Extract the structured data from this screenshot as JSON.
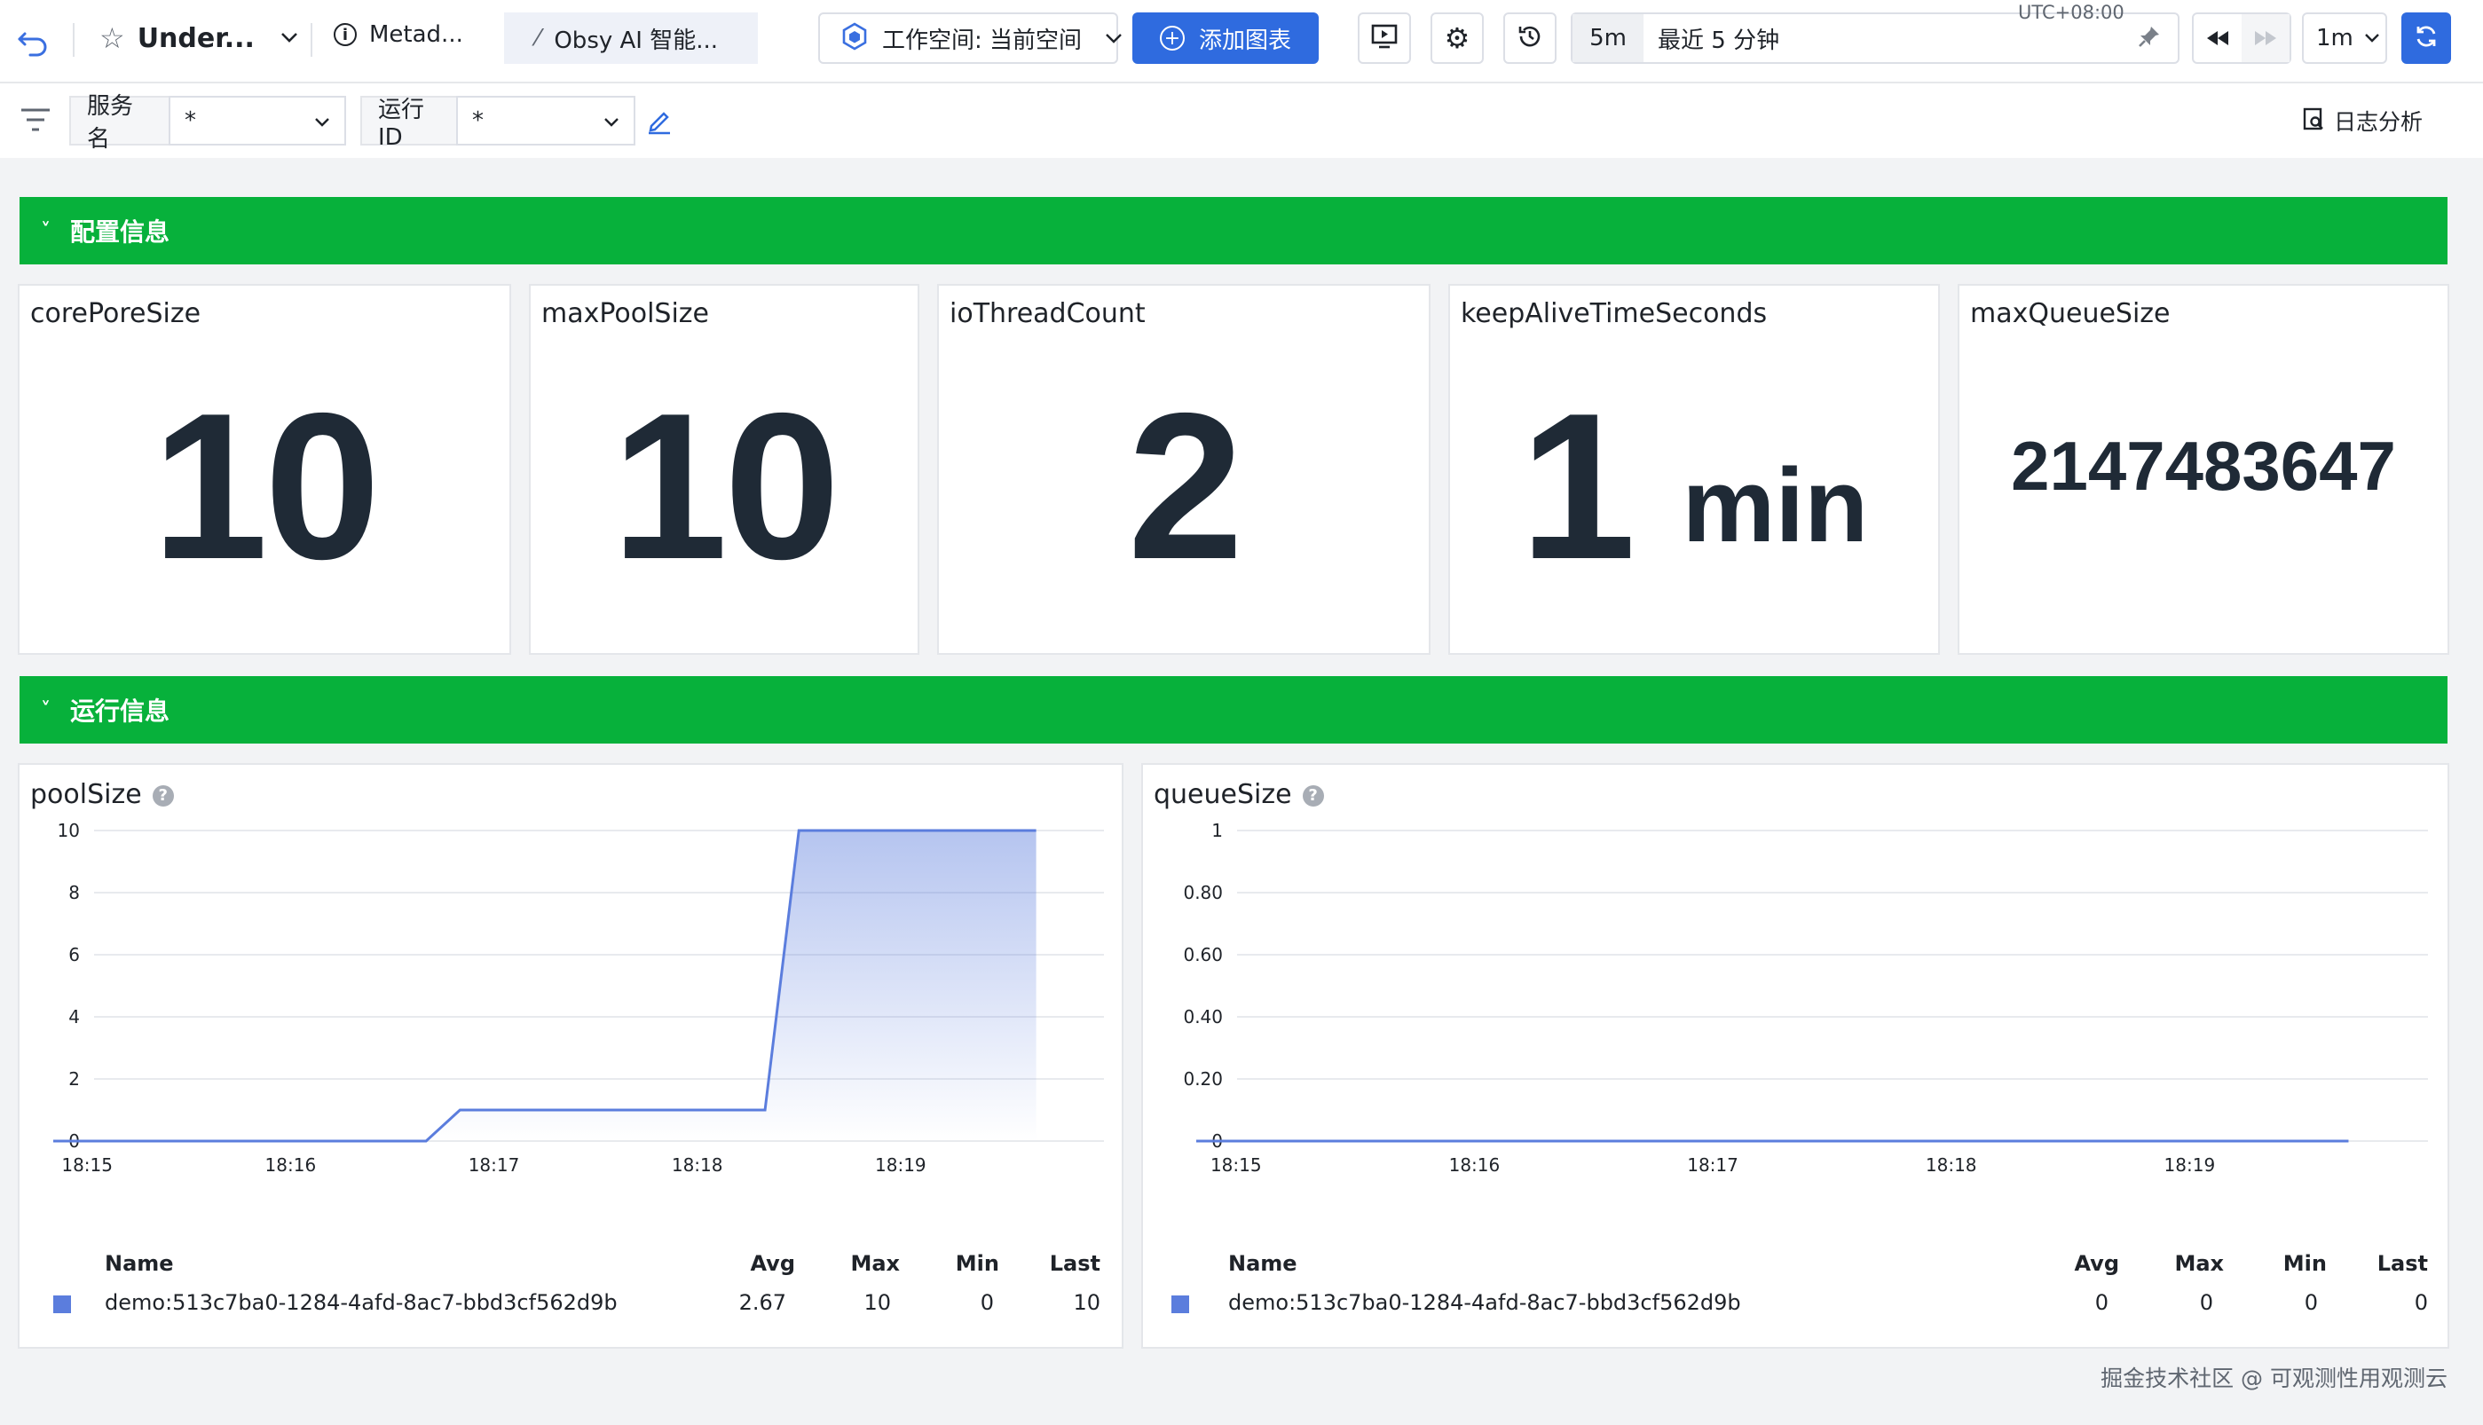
{
  "toolbar": {
    "dashboard_title": "Under...",
    "metadata_label": "Metad...",
    "ai_label": "Obsy AI 智能...",
    "workspace_label": "工作空间: 当前空间",
    "add_chart_label": "添加图表",
    "timezone": "UTC+08:00",
    "range_short": "5m",
    "range_label": "最近 5 分钟",
    "refresh_interval": "1m"
  },
  "filters": {
    "items": [
      {
        "label": "服务名",
        "value": "*"
      },
      {
        "label": "运行ID",
        "value": "*"
      }
    ],
    "log_analysis_label": "日志分析"
  },
  "sections": {
    "config": "配置信息",
    "runtime": "运行信息"
  },
  "stats": [
    {
      "title": "corePoreSize",
      "value": "10",
      "unit": ""
    },
    {
      "title": "maxPoolSize",
      "value": "10",
      "unit": ""
    },
    {
      "title": "ioThreadCount",
      "value": "2",
      "unit": ""
    },
    {
      "title": "keepAliveTimeSeconds",
      "value": "1",
      "unit": "min"
    },
    {
      "title": "maxQueueSize",
      "value": "2147483647",
      "unit": ""
    }
  ],
  "legend_headers": {
    "name": "Name",
    "avg": "Avg",
    "max": "Max",
    "min": "Min",
    "last": "Last"
  },
  "chart_data": [
    {
      "type": "area",
      "title": "poolSize",
      "x_ticks": [
        "18:15",
        "18:16",
        "18:17",
        "18:18",
        "18:19"
      ],
      "y_ticks": [
        "0",
        "2",
        "4",
        "6",
        "8",
        "10"
      ],
      "ylim": [
        0,
        10
      ],
      "grid": true,
      "series": [
        {
          "name": "demo:513c7ba0-1284-4afd-8ac7-bbd3cf562d9b",
          "color": "#5b7ddd",
          "points": [
            [
              "18:14:50",
              0
            ],
            [
              "18:16:40",
              0
            ],
            [
              "18:16:50",
              1
            ],
            [
              "18:17:00",
              1
            ],
            [
              "18:18:20",
              1
            ],
            [
              "18:18:30",
              10
            ],
            [
              "18:19:40",
              10
            ]
          ],
          "stats": {
            "avg": "2.67",
            "max": "10",
            "min": "0",
            "last": "10"
          }
        }
      ]
    },
    {
      "type": "line",
      "title": "queueSize",
      "x_ticks": [
        "18:15",
        "18:16",
        "18:17",
        "18:18",
        "18:19"
      ],
      "y_ticks": [
        "0",
        "0.20",
        "0.40",
        "0.60",
        "0.80",
        "1"
      ],
      "ylim": [
        0,
        1
      ],
      "grid": true,
      "series": [
        {
          "name": "demo:513c7ba0-1284-4afd-8ac7-bbd3cf562d9b",
          "color": "#5b7ddd",
          "points": [
            [
              "18:14:50",
              0
            ],
            [
              "18:19:40",
              0
            ]
          ],
          "stats": {
            "avg": "0",
            "max": "0",
            "min": "0",
            "last": "0"
          }
        }
      ]
    }
  ],
  "watermark": "掘金技术社区 @ 可观测性用观测云"
}
